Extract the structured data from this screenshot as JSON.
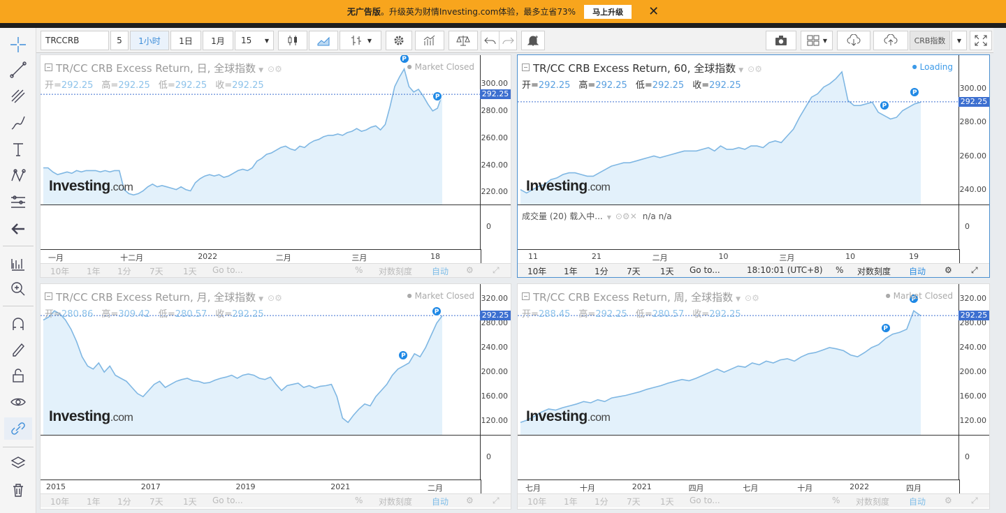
{
  "banner": {
    "text_bold": "无广告版",
    "text": "。升级英为财情Investing.com体验，最多立省73%",
    "button": "马上升级",
    "close": "✕"
  },
  "toolbar": {
    "symbol": "TRCCRB",
    "interval_count": "5",
    "tf_1h": "1小时",
    "tf_1d": "1日",
    "tf_1m": "1月",
    "tf_15": "15",
    "compare": "CRB指数"
  },
  "logo": {
    "main": "Investing",
    "suffix": ".com"
  },
  "panes": [
    {
      "title": "TR/CC CRB Excess Return, 日, 全球指数",
      "status": "Market Closed",
      "ohlc": [
        {
          "k": "开=",
          "v": "292.25"
        },
        {
          "k": "高=",
          "v": "292.25"
        },
        {
          "k": "低=",
          "v": "292.25"
        },
        {
          "k": "收=",
          "v": "292.25"
        }
      ],
      "last": "292.25",
      "yticks": [
        "300.00",
        "280.00",
        "260.00",
        "240.00",
        "220.00"
      ],
      "vol_zero": "0",
      "xticks": [
        "一月",
        "十二月",
        "2022",
        "二月",
        "三月",
        "18"
      ],
      "bottom": [
        "10年",
        "1年",
        "1分",
        "7天",
        "1天",
        "Go to...",
        "%",
        "对数刻度",
        "自动"
      ],
      "chart_data": {
        "type": "area",
        "ylim": [
          212,
          315
        ],
        "values": [
          238,
          238,
          235,
          233,
          234,
          235,
          234,
          236,
          235,
          236,
          236,
          236,
          235,
          236,
          235,
          236,
          236,
          222,
          219,
          218,
          219,
          221,
          224,
          226,
          224,
          225,
          224,
          223,
          222,
          224,
          222,
          221,
          227,
          230,
          232,
          233,
          232,
          233,
          231,
          232,
          234,
          236,
          237,
          236,
          238,
          243,
          245,
          248,
          249,
          251,
          253,
          254,
          252,
          251,
          254,
          253,
          256,
          258,
          259,
          261,
          262,
          262,
          263,
          262,
          264,
          265,
          267,
          265,
          266,
          268,
          269,
          266,
          270,
          283,
          298,
          305,
          311,
          298,
          294,
          296,
          291,
          285,
          280,
          282,
          292
        ]
      }
    },
    {
      "title": "TR/CC CRB Excess Return, 60, 全球指数",
      "status": "Loading",
      "ohlc": [
        {
          "k": "开=",
          "v": "292.25"
        },
        {
          "k": "高=",
          "v": "292.25"
        },
        {
          "k": "低=",
          "v": "292.25"
        },
        {
          "k": "收=",
          "v": "292.25"
        }
      ],
      "last": "292.25",
      "yticks": [
        "300.00",
        "280.00",
        "260.00",
        "240.00"
      ],
      "vol_label": "成交量 (20) 载入中...",
      "vol_na": "n/a   n/a",
      "vol_zero": "0",
      "xticks": [
        "11",
        "21",
        "二月",
        "10",
        "三月",
        "10",
        "19"
      ],
      "bottom": [
        "10年",
        "1年",
        "1分",
        "7天",
        "1天",
        "Go to...",
        "18:10:01 (UTC+8)",
        "%",
        "对数刻度",
        "自动"
      ],
      "chart_data": {
        "type": "area",
        "ylim": [
          232,
          315
        ],
        "values": [
          240,
          238,
          240,
          242,
          243,
          246,
          247,
          249,
          250,
          250,
          249,
          248,
          248,
          250,
          252,
          254,
          255,
          256,
          256,
          257,
          258,
          259,
          260,
          259,
          260,
          261,
          262,
          263,
          263,
          263,
          264,
          265,
          263,
          266,
          264,
          264,
          265,
          264,
          266,
          266,
          265,
          268,
          269,
          268,
          272,
          276,
          283,
          289,
          295,
          297,
          301,
          303,
          306,
          310,
          293,
          290,
          290,
          291,
          292,
          286,
          284,
          282,
          283,
          287,
          289,
          291,
          292
        ]
      }
    },
    {
      "title": "TR/CC CRB Excess Return, 月, 全球指数",
      "status": "Market Closed",
      "ohlc": [
        {
          "k": "开=",
          "v": "280.86"
        },
        {
          "k": "高=",
          "v": "309.42"
        },
        {
          "k": "低=",
          "v": "280.57"
        },
        {
          "k": "收=",
          "v": "292.25"
        }
      ],
      "last": "292.25",
      "yticks": [
        "320.00",
        "280.00",
        "240.00",
        "200.00",
        "160.00",
        "120.00"
      ],
      "vol_zero": "0",
      "xticks": [
        "2015",
        "2017",
        "2019",
        "2021",
        "二月"
      ],
      "bottom": [
        "10年",
        "1年",
        "1分",
        "7天",
        "1天",
        "Go to...",
        "%",
        "对数刻度",
        "自动"
      ],
      "chart_data": {
        "type": "area",
        "ylim": [
          100,
          330
        ],
        "values": [
          285,
          290,
          300,
          295,
          285,
          270,
          250,
          225,
          210,
          205,
          215,
          200,
          210,
          195,
          190,
          185,
          175,
          165,
          160,
          170,
          180,
          185,
          175,
          180,
          185,
          188,
          190,
          186,
          185,
          182,
          183,
          187,
          190,
          192,
          195,
          190,
          195,
          197,
          195,
          190,
          188,
          192,
          180,
          170,
          178,
          180,
          182,
          175,
          178,
          174,
          177,
          178,
          180,
          160,
          125,
          118,
          130,
          140,
          148,
          145,
          160,
          170,
          180,
          195,
          205,
          210,
          215,
          230,
          225,
          240,
          260,
          280,
          292
        ]
      }
    },
    {
      "title": "TR/CC CRB Excess Return, 周, 全球指数",
      "status": "Market Closed",
      "ohlc": [
        {
          "k": "开=",
          "v": "288.45"
        },
        {
          "k": "高=",
          "v": "292.25"
        },
        {
          "k": "低=",
          "v": "280.57"
        },
        {
          "k": "收=",
          "v": "292.25"
        }
      ],
      "last": "292.25",
      "yticks": [
        "320.00",
        "280.00",
        "240.00",
        "200.00",
        "160.00",
        "120.00"
      ],
      "vol_zero": "0",
      "xticks": [
        "七月",
        "十月",
        "2021",
        "四月",
        "七月",
        "十月",
        "2022",
        "四月"
      ],
      "bottom": [
        "10年",
        "1年",
        "1分",
        "7天",
        "1天",
        "Go to...",
        "%",
        "对数刻度",
        "自动"
      ],
      "chart_data": {
        "type": "area",
        "ylim": [
          100,
          330
        ],
        "values": [
          118,
          122,
          128,
          135,
          140,
          138,
          142,
          145,
          148,
          152,
          150,
          155,
          152,
          158,
          160,
          162,
          165,
          168,
          172,
          175,
          178,
          182,
          185,
          188,
          186,
          190,
          195,
          200,
          205,
          200,
          205,
          210,
          208,
          215,
          212,
          218,
          215,
          220,
          222,
          218,
          225,
          230,
          232,
          236,
          240,
          238,
          235,
          228,
          225,
          232,
          240,
          245,
          255,
          262,
          265,
          270,
          300,
          292
        ]
      }
    }
  ]
}
